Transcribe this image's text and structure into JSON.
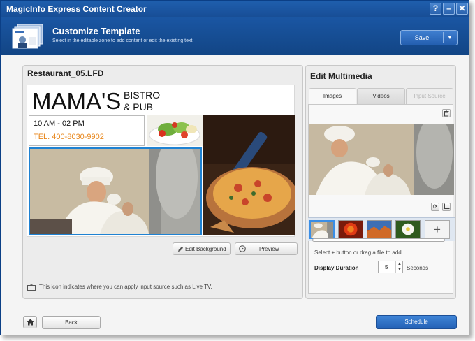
{
  "window": {
    "title": "MagicInfo Express Content Creator",
    "controls": [
      "?",
      "–",
      "✕"
    ]
  },
  "header": {
    "title": "Customize Template",
    "subtitle": "Select in the editable zone to add content or edit the existing text.",
    "save_label": "Save",
    "save_menu_icon": "caret-down-icon"
  },
  "template": {
    "file_name": "Restaurant_05.LFD",
    "brand": "MAMA'S",
    "brand_sub_line1": "BISTRO",
    "brand_sub_line2": "& PUB",
    "hours": "10 AM - 02 PM",
    "phone": "TEL. 400-8030-9902",
    "accent_color": "#e8861a",
    "selection_color": "#1f82d2"
  },
  "canvas_actions": {
    "edit_background": "Edit Background",
    "preview": "Preview"
  },
  "footnote": "This icon indicates where you can apply input source such as Live TV.",
  "multimedia": {
    "title": "Edit Multimedia",
    "tabs": [
      {
        "label": "Images",
        "state": "active"
      },
      {
        "label": "Videos",
        "state": "normal"
      },
      {
        "label": "Input Source",
        "state": "disabled"
      }
    ],
    "hint": "Select + button or drag a file to add.",
    "duration_label": "Display Duration",
    "duration_value": "5",
    "duration_unit": "Seconds",
    "add_symbol": "+"
  },
  "footer": {
    "back_label": "Back",
    "schedule_label": "Schedule"
  }
}
